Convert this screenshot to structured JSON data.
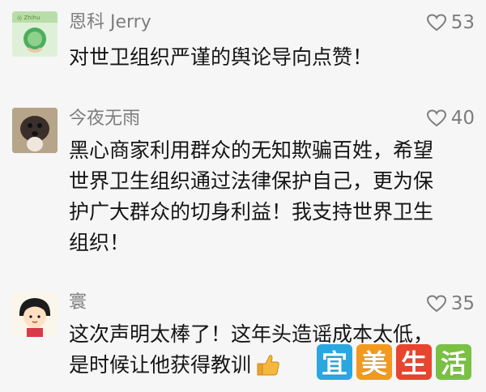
{
  "comments": [
    {
      "username": "恩科 Jerry",
      "likes": "53",
      "lines": [
        "对世卫组织严谨的舆论导向点赞！"
      ],
      "avatar_icon": "green-leaf-globe-avatar"
    },
    {
      "username": "今夜无雨",
      "likes": "40",
      "lines": [
        "黑心商家利用群众的无知欺骗百姓，希望",
        "世界卫生组织通过法律保护自己，更为保",
        "护广大群众的切身利益！我支持世界卫生",
        "组织！"
      ],
      "avatar_icon": "dog-photo-avatar"
    },
    {
      "username": "寰",
      "likes": "35",
      "lines": [
        "这次声明太棒了！这年头造谣成本太低，",
        "是时候让他获得教训"
      ],
      "avatar_icon": "cartoon-girl-avatar",
      "emoji": "thumbs-up-emoji"
    }
  ],
  "watermark": {
    "chars": [
      "宜",
      "美",
      "生",
      "活"
    ],
    "colors": [
      "#2aa7e0",
      "#f39a1e",
      "#e8452f",
      "#7ac143"
    ]
  },
  "colors": {
    "background": "#f6f6f6",
    "username": "#7d7d7d",
    "text": "#151515"
  }
}
